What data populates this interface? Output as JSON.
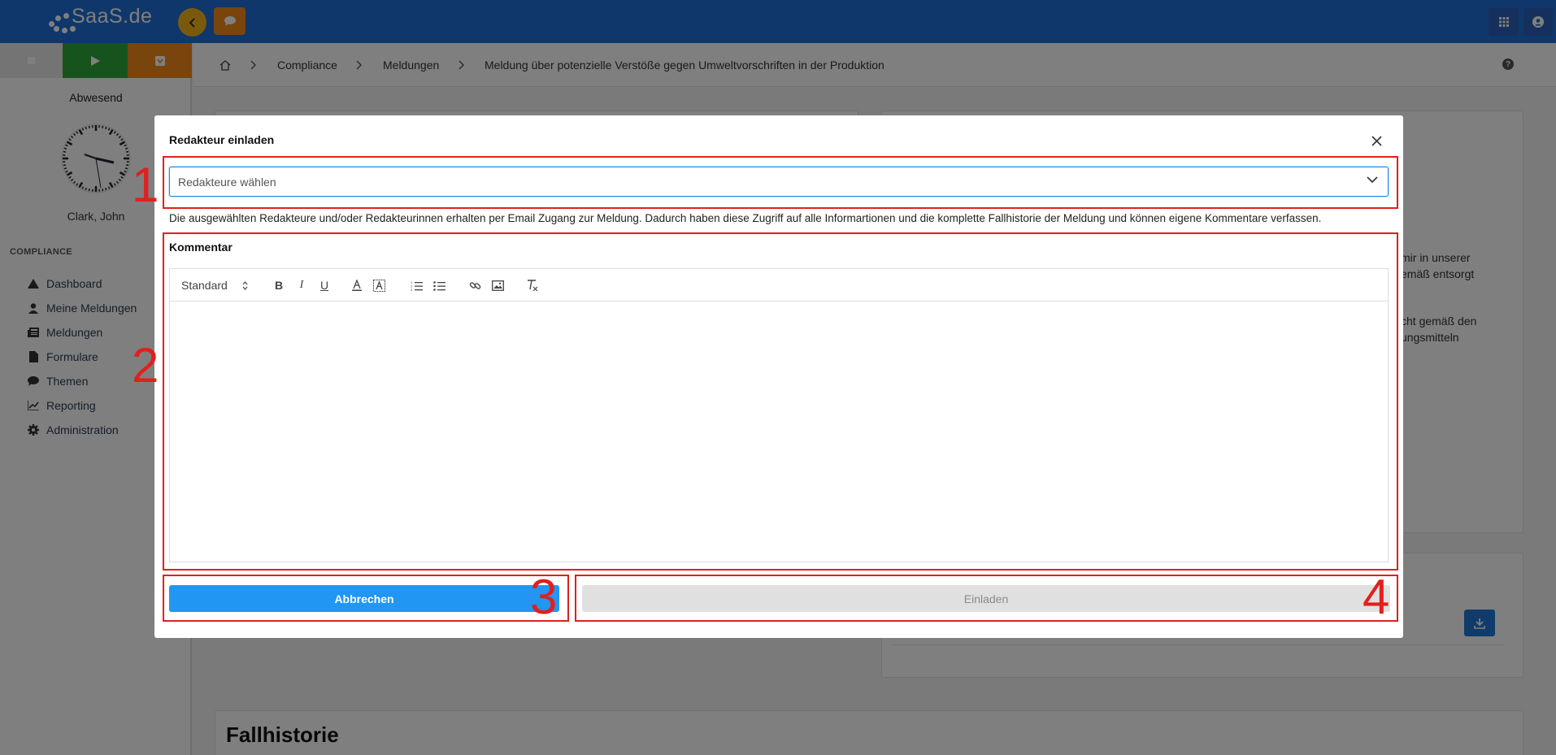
{
  "topbar": {
    "logo_text": "SaaS.de",
    "colors": {
      "bar": "#1f6fd6",
      "back": "#f2b51b",
      "chat": "#f28b1a"
    }
  },
  "sidebar": {
    "status": "Abwesend",
    "user_name": "Clark, John",
    "section_title": "COMPLIANCE",
    "items": [
      {
        "label": "Dashboard",
        "icon": "dashboard-icon"
      },
      {
        "label": "Meine Meldungen",
        "icon": "user-icon"
      },
      {
        "label": "Meldungen",
        "icon": "newspaper-icon"
      },
      {
        "label": "Formulare",
        "icon": "file-icon"
      },
      {
        "label": "Themen",
        "icon": "comment-icon"
      },
      {
        "label": "Reporting",
        "icon": "chart-icon"
      },
      {
        "label": "Administration",
        "icon": "gear-icon"
      }
    ]
  },
  "breadcrumb": {
    "items": [
      "Compliance",
      "Meldungen",
      "Meldung über potenzielle Verstöße gegen Umweltvorschriften in der Produktion"
    ]
  },
  "background": {
    "right_text_lines_1": [
      "mir in unserer",
      "emäß entsorgt"
    ],
    "right_text_lines_2": [
      "cht gemäß den",
      "ungsmitteln"
    ],
    "case_history_title": "Fallhistorie"
  },
  "modal": {
    "title": "Redakteur einladen",
    "select_placeholder": "Redakteure wählen",
    "info_text": "Die ausgewählten Redakteure und/oder Redakteurinnen erhalten per Email Zugang zur Meldung. Dadurch haben diese Zugriff auf alle Informartionen und die komplette Fallhistorie der Meldung und können eigene Kommentare verfassen.",
    "comment_label": "Kommentar",
    "toolbar": {
      "heading_select": "Standard",
      "bold": "B",
      "italic": "I",
      "underline": "U"
    },
    "cancel_label": "Abbrechen",
    "invite_label": "Einladen"
  },
  "annotations": [
    "1",
    "2",
    "3",
    "4"
  ]
}
